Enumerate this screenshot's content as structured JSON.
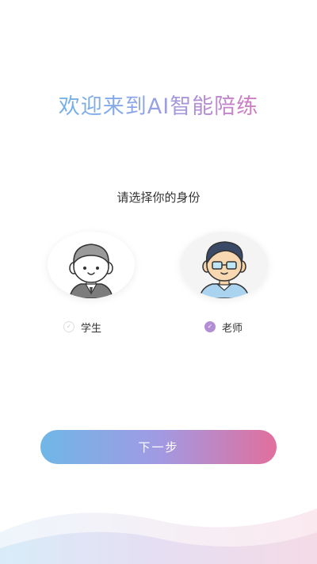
{
  "header": {
    "welcome_title": "欢迎来到AI智能陪练"
  },
  "identity": {
    "prompt": "请选择你的身份",
    "options": [
      {
        "label": "学生",
        "selected": false,
        "icon": "student-avatar-icon"
      },
      {
        "label": "老师",
        "selected": true,
        "icon": "teacher-avatar-icon"
      }
    ]
  },
  "actions": {
    "next_label": "下一步"
  },
  "colors": {
    "accent_blue": "#6fb7e6",
    "accent_purple": "#b48ed4",
    "accent_pink": "#e26f9d"
  }
}
